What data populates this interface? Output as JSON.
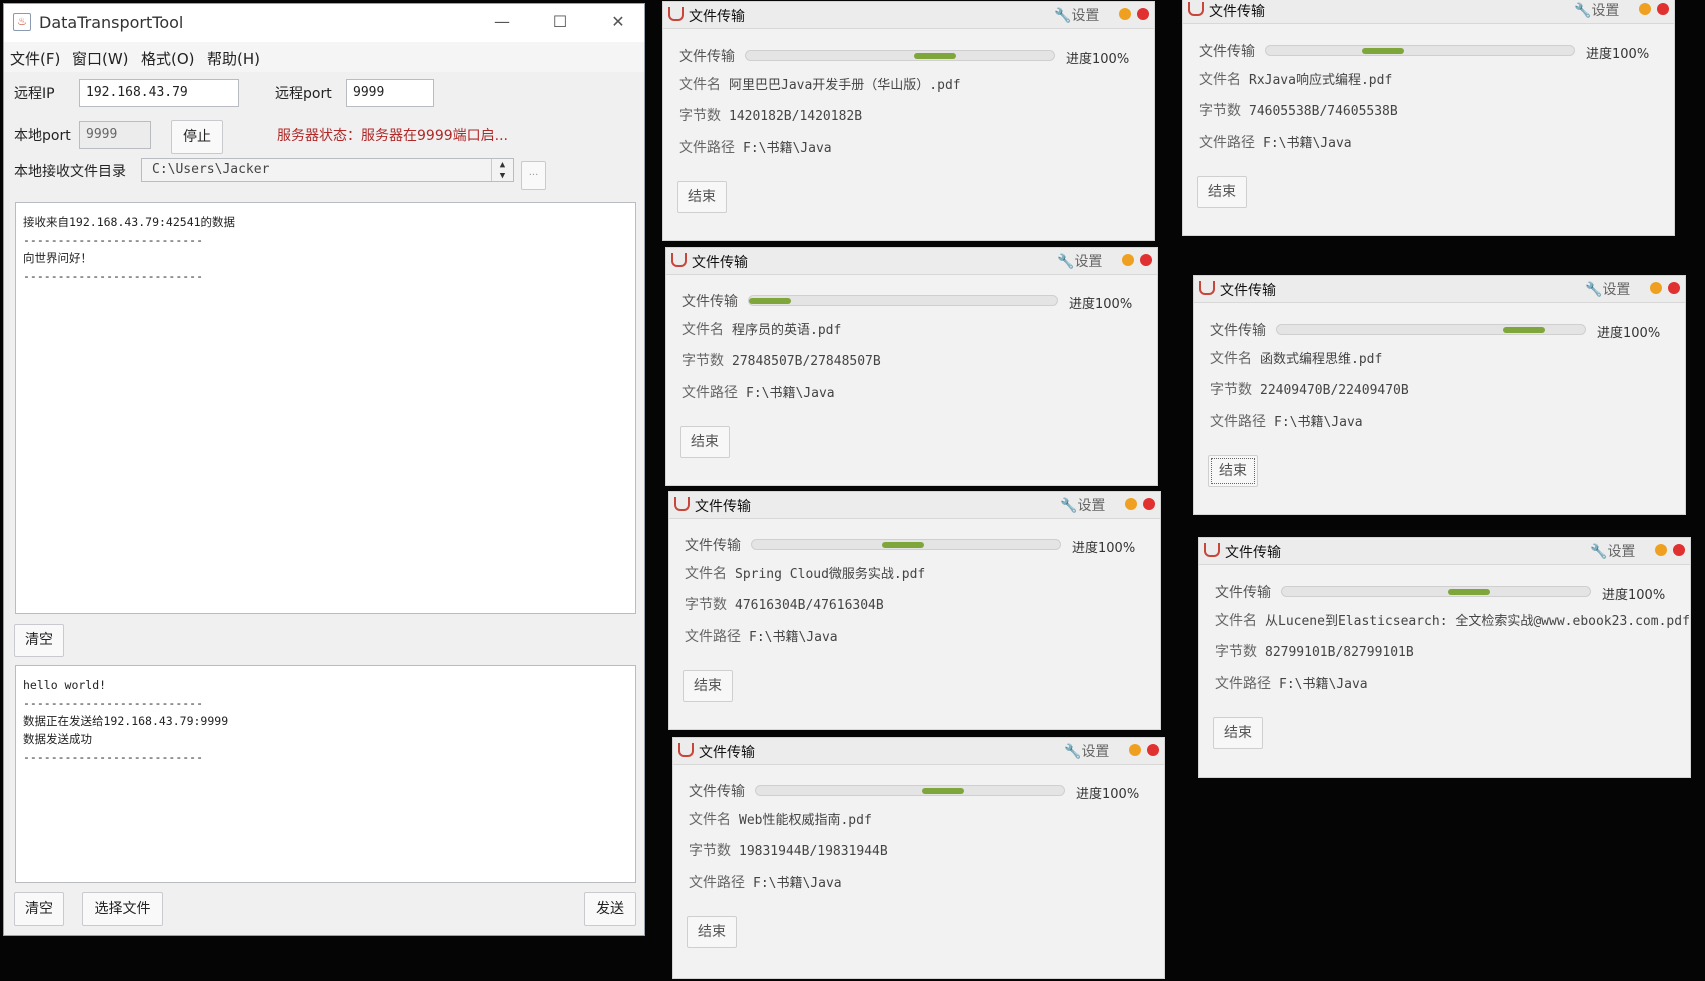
{
  "main": {
    "title": "DataTransportTool",
    "window_buttons": {
      "minimize": "—",
      "maximize": "☐",
      "close": "✕"
    },
    "menu": [
      "文件(F)",
      "窗口(W)",
      "格式(O)",
      "帮助(H)"
    ],
    "remote_ip_label": "远程IP",
    "remote_ip_value": "192.168.43.79",
    "remote_port_label": "远程port",
    "remote_port_value": "9999",
    "local_port_label": "本地port",
    "local_port_value": "9999",
    "stop_label": "停止",
    "status_text": "服务器状态：服务器在9999端口启...",
    "recv_dir_label": "本地接收文件目录",
    "recv_dir_value": "C:\\Users\\Jacker",
    "recv_dir_button": "...",
    "receive_lines": [
      "接收来自192.168.43.79:42541的数据",
      "--------------------------",
      "向世界问好！",
      "--------------------------"
    ],
    "clear_label_1": "清空",
    "send_lines": [
      "hello world!",
      "--------------------------",
      "数据正在发送给192.168.43.79:9999",
      "数据发送成功",
      "--------------------------"
    ],
    "clear_label_2": "清空",
    "choose_file_label": "选择文件",
    "send_label": "发送"
  },
  "transfer_panels": [
    {
      "title": "文件传输",
      "settings": "设置",
      "transfer_label": "文件传输",
      "progress_text": "进度100%",
      "progress": 1.0,
      "filename_label": "文件名",
      "filename": "阿里巴巴Java开发手册（华山版）.pdf",
      "bytes_label": "字节数",
      "bytes": "1420182B/1420182B",
      "path_label": "文件路径",
      "path": "F:\\书籍\\Java",
      "end_label": "结束"
    },
    {
      "title": "文件传输",
      "settings": "设置",
      "transfer_label": "文件传输",
      "progress_text": "进度100%",
      "progress": 1.0,
      "filename_label": "文件名",
      "filename": "程序员的英语.pdf",
      "bytes_label": "字节数",
      "bytes": "27848507B/27848507B",
      "path_label": "文件路径",
      "path": "F:\\书籍\\Java",
      "end_label": "结束"
    },
    {
      "title": "文件传输",
      "settings": "设置",
      "transfer_label": "文件传输",
      "progress_text": "进度100%",
      "progress": 1.0,
      "filename_label": "文件名",
      "filename": "Spring Cloud微服务实战.pdf",
      "bytes_label": "字节数",
      "bytes": "47616304B/47616304B",
      "path_label": "文件路径",
      "path": "F:\\书籍\\Java",
      "end_label": "结束"
    },
    {
      "title": "文件传输",
      "settings": "设置",
      "transfer_label": "文件传输",
      "progress_text": "进度100%",
      "progress": 1.0,
      "filename_label": "文件名",
      "filename": "Web性能权威指南.pdf",
      "bytes_label": "字节数",
      "bytes": "19831944B/19831944B",
      "path_label": "文件路径",
      "path": "F:\\书籍\\Java",
      "end_label": "结束"
    },
    {
      "title": "文件传输",
      "settings": "设置",
      "transfer_label": "文件传输",
      "progress_text": "进度100%",
      "progress": 1.0,
      "filename_label": "文件名",
      "filename": "RxJava响应式编程.pdf",
      "bytes_label": "字节数",
      "bytes": "74605538B/74605538B",
      "path_label": "文件路径",
      "path": "F:\\书籍\\Java",
      "end_label": "结束"
    },
    {
      "title": "文件传输",
      "settings": "设置",
      "transfer_label": "文件传输",
      "progress_text": "进度100%",
      "progress": 1.0,
      "filename_label": "文件名",
      "filename": "函数式编程思维.pdf",
      "bytes_label": "字节数",
      "bytes": "22409470B/22409470B",
      "path_label": "文件路径",
      "path": "F:\\书籍\\Java",
      "end_label": "结束"
    },
    {
      "title": "文件传输",
      "settings": "设置",
      "transfer_label": "文件传输",
      "progress_text": "进度100%",
      "progress": 1.0,
      "filename_label": "文件名",
      "filename": "从Lucene到Elasticsearch: 全文检索实战@www.ebook23.com.pdf",
      "bytes_label": "字节数",
      "bytes": "82799101B/82799101B",
      "path_label": "文件路径",
      "path": "F:\\书籍\\Java",
      "end_label": "结束"
    }
  ],
  "colors": {
    "progress_fill": "#7ea63a",
    "dot_orange": "#f0a020",
    "dot_red": "#e03030",
    "status_red": "#b02828"
  },
  "icons": [
    "java-cup-icon",
    "wrench-icon",
    "minimize-icon",
    "maximize-icon",
    "close-icon"
  ]
}
